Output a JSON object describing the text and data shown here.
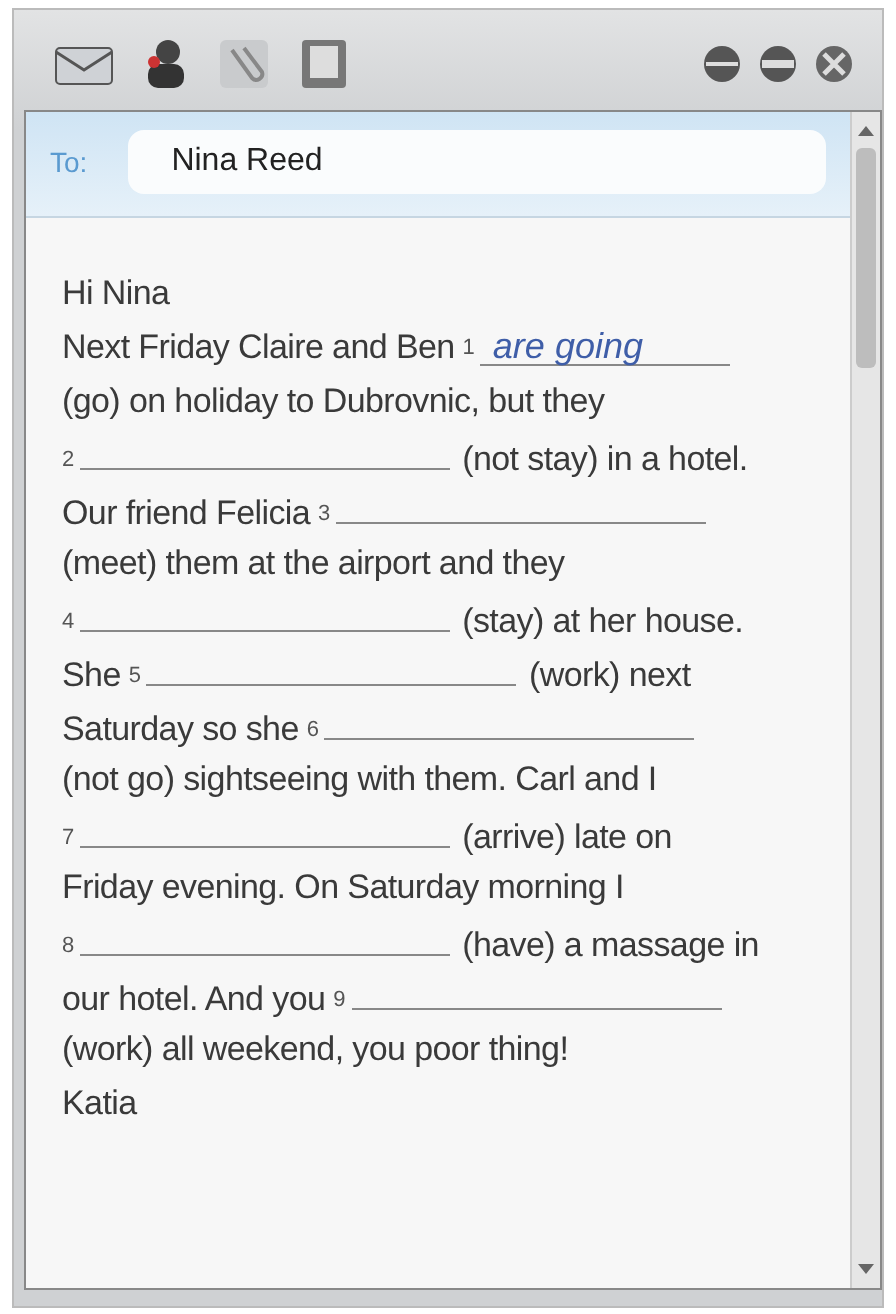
{
  "message": {
    "to_label": "To:",
    "to": "Nina Reed"
  },
  "lines": [
    [
      {
        "kind": "text",
        "text": "Hi Nina"
      }
    ],
    [
      {
        "kind": "text",
        "text": "Next Friday Claire and Ben"
      },
      {
        "kind": "gap",
        "number": "1",
        "answer": "are going"
      }
    ],
    [
      {
        "kind": "text",
        "text": "(go) on holiday to Dubrovnic, but they"
      }
    ],
    [
      {
        "kind": "gap",
        "number": "2"
      },
      {
        "kind": "text",
        "text": "(not stay) in a hotel."
      }
    ],
    [
      {
        "kind": "text",
        "text": "Our friend Felicia"
      },
      {
        "kind": "gap",
        "number": "3"
      }
    ],
    [
      {
        "kind": "text",
        "text": "(meet) them at the airport and they"
      }
    ],
    [
      {
        "kind": "gap",
        "number": "4"
      },
      {
        "kind": "text",
        "text": "(stay) at her house."
      }
    ],
    [
      {
        "kind": "text",
        "text": "She"
      },
      {
        "kind": "gap",
        "number": "5"
      },
      {
        "kind": "text",
        "text": "(work) next"
      }
    ],
    [
      {
        "kind": "text",
        "text": "Saturday so she"
      },
      {
        "kind": "gap",
        "number": "6"
      }
    ],
    [
      {
        "kind": "text",
        "text": "(not go) sightseeing with them. Carl and I"
      }
    ],
    [
      {
        "kind": "gap",
        "number": "7"
      },
      {
        "kind": "text",
        "text": "(arrive) late on"
      }
    ],
    [
      {
        "kind": "text",
        "text": "Friday evening. On Saturday morning I"
      }
    ],
    [
      {
        "kind": "gap",
        "number": "8"
      },
      {
        "kind": "text",
        "text": "(have) a massage in"
      }
    ],
    [
      {
        "kind": "text",
        "text": "our hotel. And you"
      },
      {
        "kind": "gap",
        "number": "9"
      }
    ],
    [
      {
        "kind": "text",
        "text": "(work) all weekend, you poor thing!"
      }
    ],
    [
      {
        "kind": "text",
        "text": "Katia"
      }
    ]
  ]
}
